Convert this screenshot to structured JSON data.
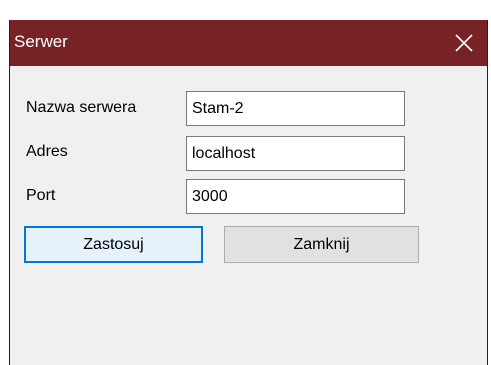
{
  "window": {
    "title": "Serwer",
    "close_icon": "close-icon",
    "titlebar_color": "#772325"
  },
  "form": {
    "server_name_label": "Nazwa serwera",
    "server_name_value": "Stam-2",
    "address_label": "Adres",
    "address_value": "localhost",
    "port_label": "Port",
    "port_value": "3000"
  },
  "buttons": {
    "apply_label": "Zastosuj",
    "close_label": "Zamknij"
  }
}
